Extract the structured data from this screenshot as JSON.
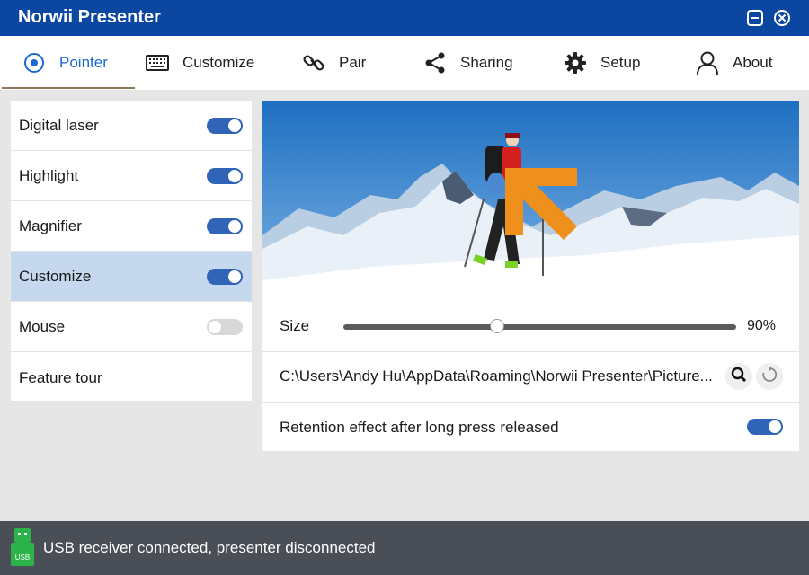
{
  "app": {
    "title": "Norwii Presenter"
  },
  "window": {
    "minimize_icon": "minimize-icon",
    "close_icon": "close-icon"
  },
  "nav": {
    "tabs": [
      {
        "label": "Pointer",
        "icon": "pointer-icon",
        "active": true
      },
      {
        "label": "Customize",
        "icon": "keyboard-icon"
      },
      {
        "label": "Pair",
        "icon": "link-icon"
      },
      {
        "label": "Sharing",
        "icon": "share-icon"
      },
      {
        "label": "Setup",
        "icon": "gear-icon"
      },
      {
        "label": "About",
        "icon": "user-icon"
      }
    ]
  },
  "sidebar": {
    "items": [
      {
        "label": "Digital laser",
        "toggle": true
      },
      {
        "label": "Highlight",
        "toggle": true
      },
      {
        "label": "Magnifier",
        "toggle": true
      },
      {
        "label": "Customize",
        "toggle": true,
        "selected": true
      },
      {
        "label": "Mouse",
        "toggle": false
      },
      {
        "label": "Feature tour"
      }
    ]
  },
  "settings": {
    "size_label": "Size",
    "size_value": "90%",
    "size_level": 0.4,
    "path": "C:\\Users\\Andy Hu\\AppData\\Roaming\\Norwii Presenter\\Picture...",
    "retention_label": "Retention effect after long press released",
    "retention_on": true
  },
  "status": {
    "message": "USB receiver connected, presenter disconnected",
    "icon": "usb-icon"
  },
  "colors": {
    "accent": "#0b47a1",
    "toggle_on": "#2f64b6",
    "selected_row": "#c5d8ee",
    "status_bg": "#4a4e57",
    "cursor_arrow": "#f0901c"
  }
}
